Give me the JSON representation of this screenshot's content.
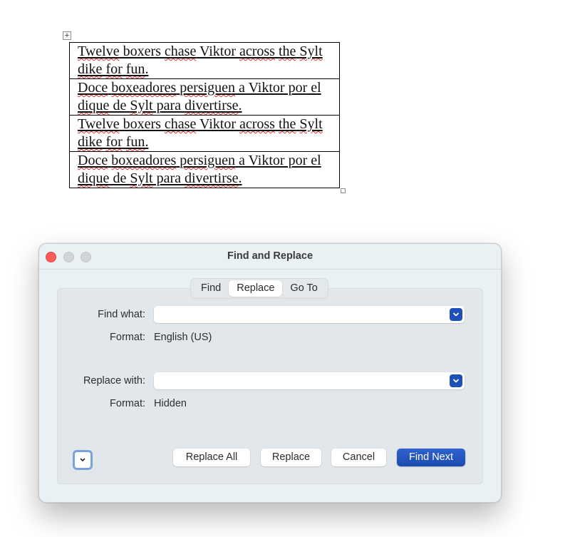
{
  "document": {
    "table": {
      "rows": [
        {
          "segments": [
            {
              "text": "Twelve",
              "spell": true
            },
            {
              "text": " boxers ",
              "spell": false
            },
            {
              "text": "chase",
              "spell": true
            },
            {
              "text": " Viktor ",
              "spell": false
            },
            {
              "text": "across",
              "spell": true
            },
            {
              "text": " ",
              "spell": false
            },
            {
              "text": "the",
              "spell": true
            },
            {
              "text": " ",
              "spell": false
            },
            {
              "text": "Sylt",
              "spell": true
            },
            {
              "text": " ",
              "spell": false
            },
            {
              "text": "dike",
              "spell": true
            },
            {
              "text": " ",
              "spell": false
            },
            {
              "text": "for",
              "spell": true
            },
            {
              "text": " ",
              "spell": false
            },
            {
              "text": "fun",
              "spell": true
            },
            {
              "text": ".",
              "spell": false
            }
          ]
        },
        {
          "segments": [
            {
              "text": "Doce",
              "spell": true
            },
            {
              "text": " ",
              "spell": false
            },
            {
              "text": "boxeadores",
              "spell": true
            },
            {
              "text": " ",
              "spell": false
            },
            {
              "text": "persiguen",
              "spell": true
            },
            {
              "text": " a Viktor por el ",
              "spell": false
            },
            {
              "text": "dique",
              "spell": true
            },
            {
              "text": " de ",
              "spell": false
            },
            {
              "text": "Sylt",
              "spell": true
            },
            {
              "text": " para ",
              "spell": false
            },
            {
              "text": "divertirse",
              "spell": true
            },
            {
              "text": ".",
              "spell": false
            }
          ]
        },
        {
          "segments": [
            {
              "text": "Twelve",
              "spell": true
            },
            {
              "text": " boxers ",
              "spell": false
            },
            {
              "text": "chase",
              "spell": true
            },
            {
              "text": " Viktor ",
              "spell": false
            },
            {
              "text": "across",
              "spell": true
            },
            {
              "text": " ",
              "spell": false
            },
            {
              "text": "the",
              "spell": true
            },
            {
              "text": " ",
              "spell": false
            },
            {
              "text": "Sylt",
              "spell": true
            },
            {
              "text": " ",
              "spell": false
            },
            {
              "text": "dike",
              "spell": true
            },
            {
              "text": " ",
              "spell": false
            },
            {
              "text": "for",
              "spell": true
            },
            {
              "text": " ",
              "spell": false
            },
            {
              "text": "fun",
              "spell": true
            },
            {
              "text": ".",
              "spell": false
            }
          ]
        },
        {
          "segments": [
            {
              "text": "Doce",
              "spell": true
            },
            {
              "text": " ",
              "spell": false
            },
            {
              "text": "boxeadores",
              "spell": true
            },
            {
              "text": " ",
              "spell": false
            },
            {
              "text": "persiguen",
              "spell": true
            },
            {
              "text": " a Viktor por el ",
              "spell": false
            },
            {
              "text": "dique",
              "spell": true
            },
            {
              "text": " de ",
              "spell": false
            },
            {
              "text": "Sylt",
              "spell": true
            },
            {
              "text": " para ",
              "spell": false
            },
            {
              "text": "divertirse",
              "spell": true
            },
            {
              "text": ".",
              "spell": false
            }
          ]
        }
      ],
      "move_handle_icon": "move-arrows-icon",
      "resize_handle_icon": "resize-square-icon"
    }
  },
  "dialog": {
    "title": "Find and Replace",
    "tabs": [
      {
        "label": "Find",
        "active": false
      },
      {
        "label": "Replace",
        "active": true
      },
      {
        "label": "Go To",
        "active": false
      }
    ],
    "find_what": {
      "label": "Find what:",
      "value": "",
      "format_label": "Format:",
      "format_value": "English (US)"
    },
    "replace_with": {
      "label": "Replace with:",
      "value": "",
      "format_label": "Format:",
      "format_value": "Hidden"
    },
    "buttons": {
      "replace_all": "Replace All",
      "replace": "Replace",
      "cancel": "Cancel",
      "find_next": "Find Next"
    },
    "colors": {
      "accent": "#1f4fb8",
      "close_button": "#fd5b57",
      "spelling_error": "#e03030"
    }
  }
}
